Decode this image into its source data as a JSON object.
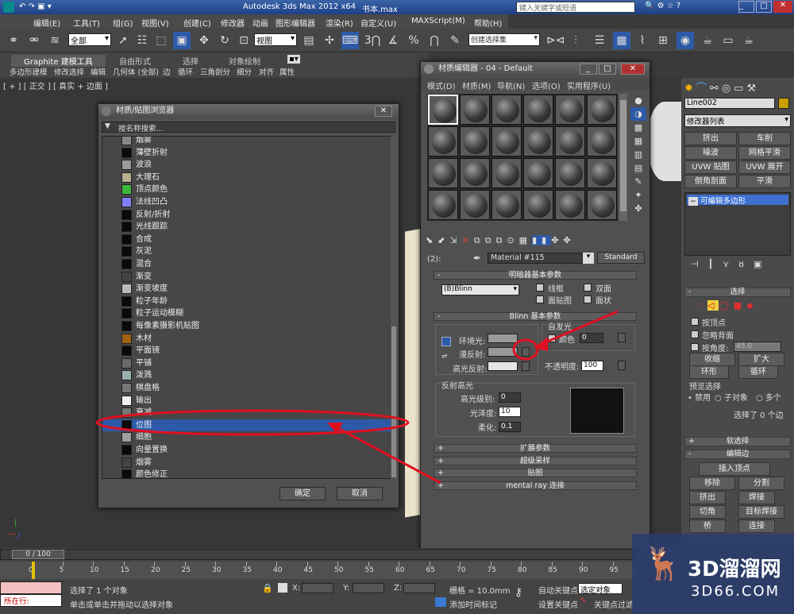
{
  "app": {
    "title": "Autodesk 3ds Max  2012 x64",
    "file": "书本.max",
    "search_placeholder": "键入关键字或短语"
  },
  "menu": [
    "编辑(E)",
    "工具(T)",
    "组(G)",
    "视图(V)",
    "创建(C)",
    "修改器",
    "动画",
    "图形编辑器",
    "渲染(R)",
    "自定义(U)",
    "MAXScript(M)",
    "帮助(H)"
  ],
  "toolbar": {
    "selection_filter": "全部",
    "ref_coord": "视图",
    "named_set": "创建选择集"
  },
  "ribbon": {
    "tabs": [
      "Graphite 建模工具",
      "自由形式",
      "选择",
      "对象绘制"
    ],
    "row2": [
      "多边形建模",
      "修改选择",
      "编辑",
      "几何体 (全部)",
      "边",
      "循环",
      "三角剖分",
      "细分",
      "对齐",
      "属性"
    ]
  },
  "viewport": {
    "label": "[ + ] [ 正交 ] [ 真实 + 边面 ]"
  },
  "browser": {
    "title": "材质/贴图浏览器",
    "search_placeholder": "按名称搜索...",
    "items": [
      {
        "label": "烟雾",
        "color": "#888888"
      },
      {
        "label": "薄壁折射",
        "color": "#0a0a0a"
      },
      {
        "label": "波浪",
        "color": "#9a9a9a"
      },
      {
        "label": "大理石",
        "color": "#b8b090"
      },
      {
        "label": "顶点颜色",
        "color": "#3cb83c"
      },
      {
        "label": "法线凹凸",
        "color": "#8080ff"
      },
      {
        "label": "反射/折射",
        "color": "#0a0a0a"
      },
      {
        "label": "光线跟踪",
        "color": "#0a0a0a"
      },
      {
        "label": "合成",
        "color": "#0a0a0a"
      },
      {
        "label": "灰泥",
        "color": "#0a0a0a"
      },
      {
        "label": "混合",
        "color": "#0a0a0a"
      },
      {
        "label": "渐变",
        "color": "#444444"
      },
      {
        "label": "渐变坡度",
        "color": "#bbbbbb"
      },
      {
        "label": "粒子年龄",
        "color": "#0a0a0a"
      },
      {
        "label": "粒子运动模糊",
        "color": "#0a0a0a"
      },
      {
        "label": "每像素摄影机贴图",
        "color": "#0a0a0a"
      },
      {
        "label": "木材",
        "color": "#a06010"
      },
      {
        "label": "平面镜",
        "color": "#0a0a0a"
      },
      {
        "label": "平铺",
        "color": "#6a6a6a"
      },
      {
        "label": "泼溅",
        "color": "#9ab0b0"
      },
      {
        "label": "棋盘格",
        "color": "#777777"
      },
      {
        "label": "输出",
        "color": "#f0f0f0"
      },
      {
        "label": "衰减",
        "color": "#777777"
      },
      {
        "label": "位图",
        "color": "#0a0a0a"
      },
      {
        "label": "细胞",
        "color": "#a0a0a0"
      },
      {
        "label": "向量置换",
        "color": "#0a0a0a"
      },
      {
        "label": "烟雾",
        "color": "#444444"
      },
      {
        "label": "颜色修正",
        "color": "#0a0a0a"
      }
    ],
    "ok": "确定",
    "cancel": "取消"
  },
  "mated": {
    "title": "材质编辑器 - 04 - Default",
    "menu": [
      "模式(D)",
      "材质(M)",
      "导航(N)",
      "选项(O)",
      "实用程序(U)"
    ],
    "slot_prefix": "(2):",
    "material_name": "Material #115",
    "material_type": "Standard",
    "shader": {
      "header": "明暗器基本参数",
      "shader_name": "(B)Blinn",
      "wire": "线框",
      "two_sided": "双面",
      "face_map": "面贴图",
      "faceted": "面状"
    },
    "blinn": {
      "header": "Blinn 基本参数",
      "self_illum": "自发光",
      "color": "颜色",
      "self_illum_value": "0",
      "ambient": "环境光:",
      "diffuse": "漫反射:",
      "specular": "高光反射:",
      "opacity": "不透明度:",
      "opacity_value": "100",
      "highlights": "反射高光",
      "spec_level": "高光级别:",
      "spec_level_value": "0",
      "gloss": "光泽度:",
      "gloss_value": "10",
      "soften": "柔化:",
      "soften_value": "0.1"
    },
    "rollouts": [
      "扩展参数",
      "超级采样",
      "贴图",
      "mental ray 连接"
    ]
  },
  "cmd": {
    "object_name": "Line002",
    "modifier_list": "修改器列表",
    "buttons": [
      "挤出",
      "车削",
      "噪波",
      "网格平滑",
      "UVW 贴图",
      "UVW 展开",
      "倒角剖面",
      "平滑"
    ],
    "stack_item": "可编辑多边形",
    "select_header": "选择",
    "by_vertex": "按顶点",
    "ignore_back": "忽略背面",
    "by_angle": "按角度:",
    "angle_value": "45.0",
    "shrink": "收缩",
    "grow": "扩大",
    "ring": "环形",
    "loop": "循环",
    "preview": "预览选择",
    "disable": "禁用",
    "subobj": "子对象",
    "multi": "多个",
    "sel_info": "选择了 0 个边",
    "soft_sel": "软选择",
    "edit_edges": "编辑边",
    "insert_vertex": "插入顶点",
    "remove": "移除",
    "split": "分割",
    "extrude": "挤出",
    "weld": "焊接",
    "chamfer": "切角",
    "target_weld": "目标焊接",
    "bridge": "桥",
    "connect": "连接"
  },
  "status": {
    "frame": "0 / 100",
    "ticks": [
      "0",
      "5",
      "10",
      "15",
      "20",
      "25",
      "30",
      "35",
      "40",
      "45",
      "50",
      "55",
      "60",
      "65",
      "70",
      "75",
      "80",
      "85",
      "90",
      "95"
    ],
    "running": "所在行:",
    "sel": "选择了 1 个对象",
    "prompt": "单击或单击并拖动以选择对象",
    "x": "X:",
    "y": "Y:",
    "z": "Z:",
    "grid": "栅格 = 10.0mm",
    "add_tag": "添加时间标记",
    "autokey": "自动关键点",
    "selected": "选定对象",
    "setkey": "设置关键点",
    "keyfilter": "关键点过滤"
  },
  "watermark": {
    "brand": "3D溜溜网",
    "url": "3D66.COM"
  },
  "colors": {
    "annotation": "#e01020",
    "highlight_row": "#2d5aa8"
  }
}
